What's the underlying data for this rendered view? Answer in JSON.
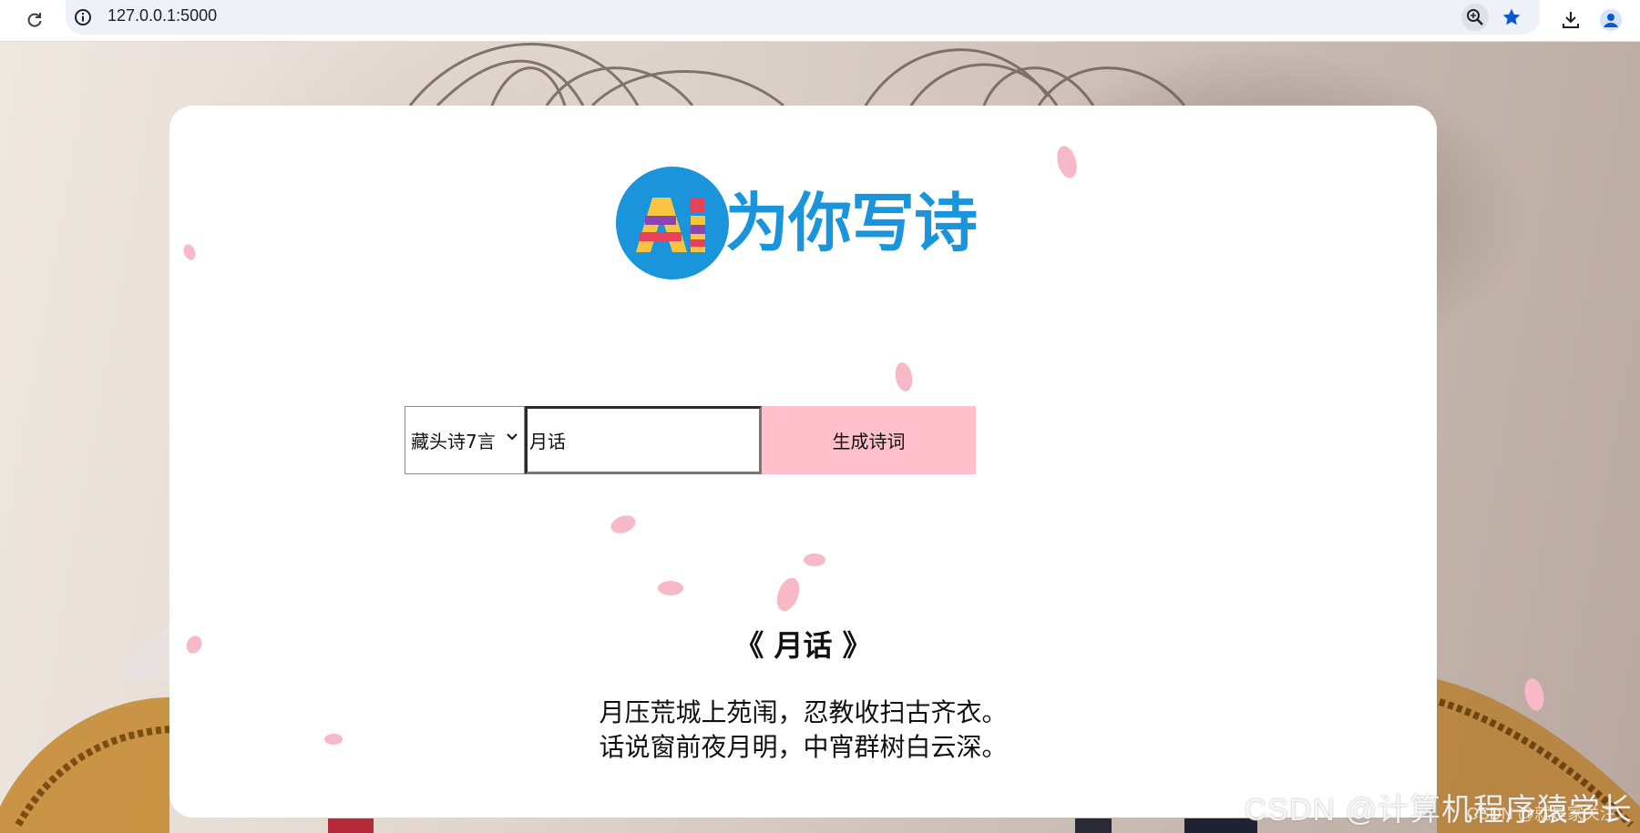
{
  "browser": {
    "url": "127.0.0.1:5000"
  },
  "app": {
    "logo_badge": "AI",
    "logo_title": "为你写诗"
  },
  "form": {
    "mode_selected": "藏头诗7言",
    "topic_value": "月话",
    "generate_label": "生成诗词"
  },
  "poem": {
    "title": "《 月话 》",
    "lines": [
      "月压荒城上苑闱，忍教收扫古齐衣。",
      "话说窗前夜月明，中宵群树白云深。"
    ]
  },
  "watermark": {
    "main": "CSDN @计算机程序猿学长",
    "sub": "CSDN @就是家关注"
  },
  "colors": {
    "brand_blue": "#1a95dc",
    "button_pink": "#ffc0cb",
    "petal_pink": "#f7b8c8"
  }
}
